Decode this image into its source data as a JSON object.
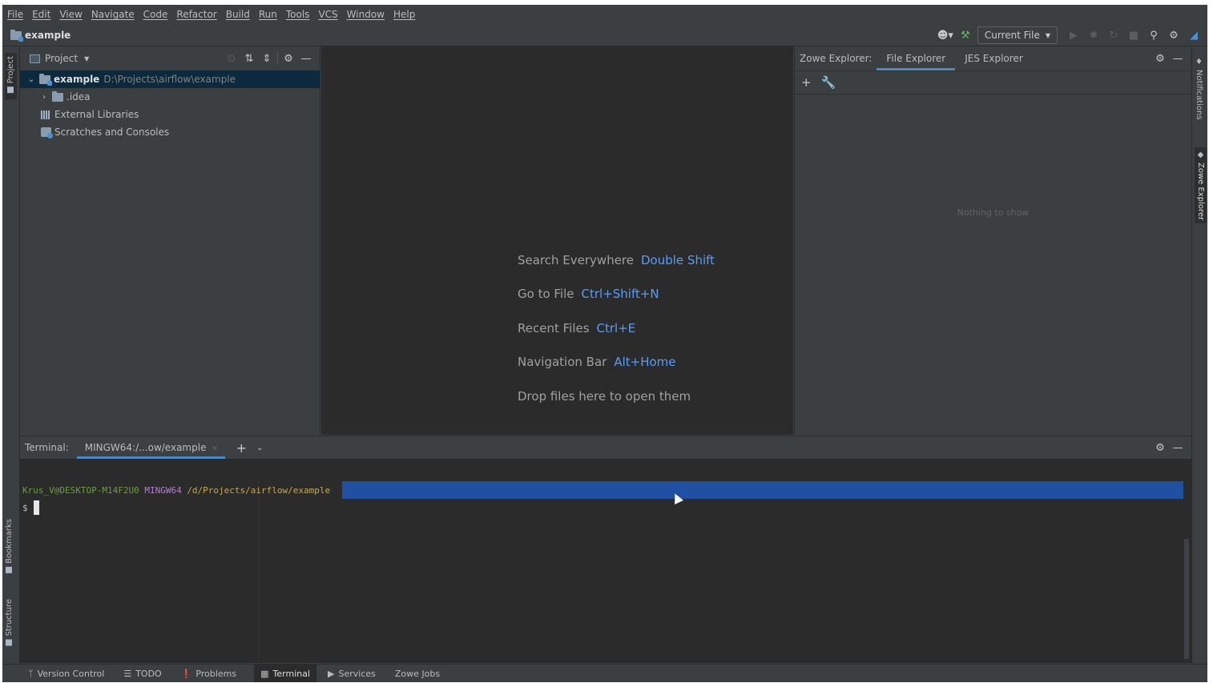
{
  "menu": [
    "File",
    "Edit",
    "View",
    "Navigate",
    "Code",
    "Refactor",
    "Build",
    "Run",
    "Tools",
    "VCS",
    "Window",
    "Help"
  ],
  "navbar": {
    "project_name": "example",
    "run_config": "Current File"
  },
  "left_stripe": {
    "project_tab": "Project",
    "bookmarks_tab": "Bookmarks",
    "structure_tab": "Structure"
  },
  "right_stripe": {
    "notifications_tab": "Notifications",
    "zowe_tab": "Zowe Explorer"
  },
  "project_panel": {
    "title": "Project",
    "tree": {
      "root_name": "example",
      "root_path": "D:\\Projects\\airflow\\example",
      "idea": ".idea",
      "external_libraries": "External Libraries",
      "scratches": "Scratches and Consoles"
    }
  },
  "editor_hints": [
    {
      "label": "Search Everywhere",
      "key": "Double Shift"
    },
    {
      "label": "Go to File",
      "key": "Ctrl+Shift+N"
    },
    {
      "label": "Recent Files",
      "key": "Ctrl+E"
    },
    {
      "label": "Navigation Bar",
      "key": "Alt+Home"
    },
    {
      "label": "Drop files here to open them",
      "key": ""
    }
  ],
  "zowe_panel": {
    "label": "Zowe Explorer:",
    "tabs": [
      "File Explorer",
      "JES Explorer"
    ],
    "active_tab": "File Explorer",
    "empty_text": "Nothing to show"
  },
  "terminal": {
    "label": "Terminal:",
    "tab_title": "MINGW64:/...ow/example",
    "prompt_user": "Krus_V@DESKTOP-M14F2U0",
    "prompt_shell": "MINGW64",
    "prompt_path": "/d/Projects/airflow/example",
    "prompt_symbol": "$"
  },
  "statusbar": {
    "items": [
      "Version Control",
      "TODO",
      "Problems",
      "Terminal",
      "Services",
      "Zowe Jobs"
    ],
    "active": "Terminal"
  },
  "colors": {
    "accent": "#4a88c7",
    "selection": "#2150a3",
    "shortcut": "#589df6"
  }
}
